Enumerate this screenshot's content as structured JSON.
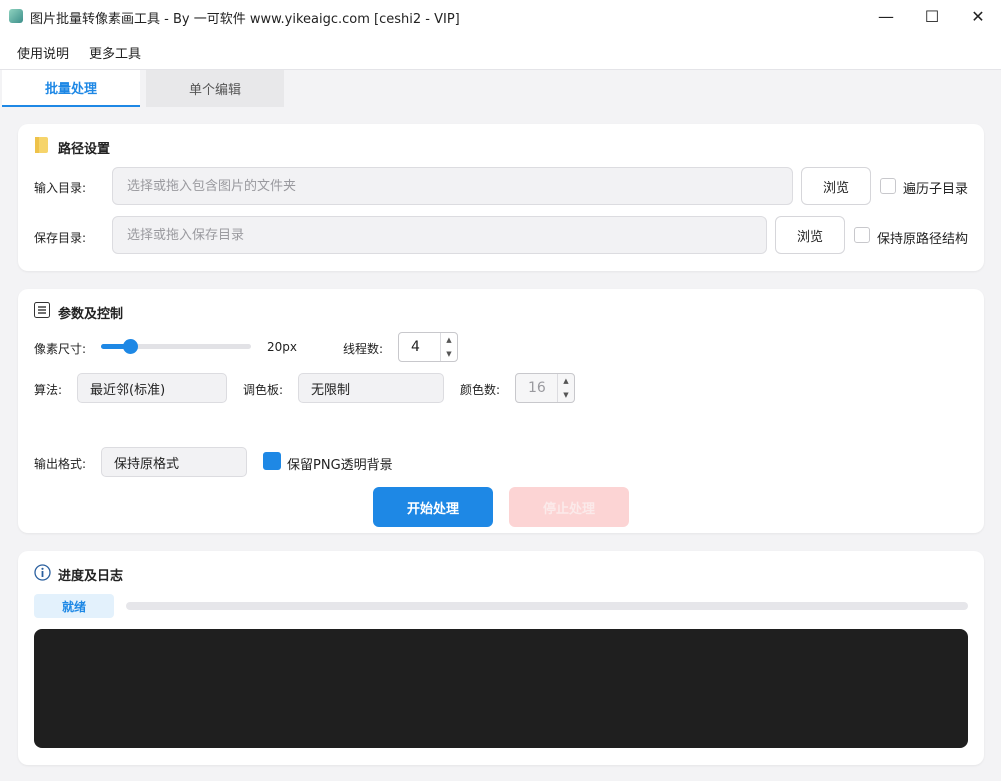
{
  "window": {
    "title": "图片批量转像素画工具 - By 一可软件 www.yikeaigc.com [ceshi2 - VIP]",
    "minimize_glyph": "—",
    "maximize_glyph": "☐",
    "close_glyph": "✕"
  },
  "menu": {
    "items": [
      "使用说明",
      "更多工具"
    ]
  },
  "tabs": [
    {
      "label": "批量处理",
      "active": true
    },
    {
      "label": "单个编辑",
      "active": false
    }
  ],
  "path_settings": {
    "title": "路径设置",
    "icon": "folder-icon",
    "input_dir": {
      "label": "输入目录:",
      "value": "",
      "placeholder": "选择或拖入包含图片的文件夹",
      "browse": "浏览",
      "checkbox_label": "遍历子目录",
      "checked": false
    },
    "save_dir": {
      "label": "保存目录:",
      "value": "",
      "placeholder": "选择或拖入保存目录",
      "browse": "浏览",
      "checkbox_label": "保持原路径结构",
      "checked": false
    }
  },
  "params": {
    "title": "参数及控制",
    "icon": "list-icon",
    "pixel_size": {
      "label": "像素尺寸:",
      "value": 20,
      "min": 1,
      "max": 100,
      "display": "20px"
    },
    "threads": {
      "label": "线程数:",
      "value": "4"
    },
    "algorithm": {
      "label": "算法:",
      "value": "最近邻(标准)"
    },
    "palette": {
      "label": "调色板:",
      "value": "无限制"
    },
    "colors": {
      "label": "颜色数:",
      "value": "16",
      "disabled": true
    },
    "output_format": {
      "label": "输出格式:",
      "value": "保持原格式"
    },
    "keep_png": {
      "label": "保留PNG透明背景",
      "checked": true
    },
    "start_button": "开始处理",
    "stop_button": "停止处理"
  },
  "progress": {
    "title": "进度及日志",
    "icon": "info-icon",
    "status": "就绪",
    "percent": 0
  },
  "colors": {
    "accent": "#1e88e5",
    "stop_disabled": "#fcd4d4",
    "log_bg": "#1f1f1f"
  }
}
